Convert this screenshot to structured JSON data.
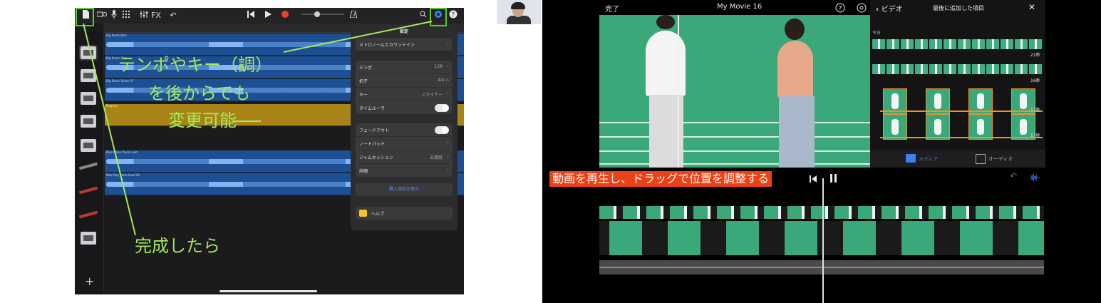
{
  "garageband": {
    "toolbar": {
      "fx_label": "FX"
    },
    "tracks": [
      {
        "name": "Big Room Kick"
      },
      {
        "name": "Big Room Clap"
      },
      {
        "name": "Big Room Snare 07"
      },
      {
        "name": "Magnus"
      },
      {
        "name": "Blue Moon Pluck Lead"
      },
      {
        "name": "New Day Pluck Lead 03"
      }
    ],
    "settings": {
      "title": "設定",
      "metronome": "メトロノームとカウントイン",
      "tempo_label": "テンポ",
      "tempo_value": "128",
      "time_sig_label": "拍子",
      "time_sig_value": "4/4 ◇",
      "key_label": "キー",
      "key_value": "Cマイナー",
      "time_ruler_label": "タイムルーラ",
      "fadeout_label": "フェードアウト",
      "notepad_label": "ノートパッド",
      "jam_label": "ジャムセッション",
      "jam_value": "未接続",
      "details_label": "詳細",
      "reset_label": "購入項目を復元",
      "help_label": "ヘルプ"
    },
    "annotations": {
      "line1": "テンポやキー（調）",
      "line2": "を後からでも",
      "line3": "変更可能",
      "done": "完成したら"
    },
    "add_label": "+"
  },
  "imovie": {
    "done_label": "完了",
    "title": "My Movie 16",
    "browser": {
      "back_label": "ビデオ",
      "title": "最後に追加した項目",
      "close": "✕",
      "today": "今日",
      "dur1": "21秒",
      "dur2": "16秒",
      "dur3": "17秒",
      "dur4": "17秒",
      "tab_media": "メディア",
      "tab_audio": "オーディオ"
    },
    "caption": "動画を再生し、ドラッグで位置を調整する"
  },
  "colors": {
    "annotation_green": "#a4e85a",
    "highlight_box": "#5ec92a",
    "caption_bg": "#ee4016",
    "track_blue": "#1f4f93",
    "track_gold": "#a88418"
  }
}
